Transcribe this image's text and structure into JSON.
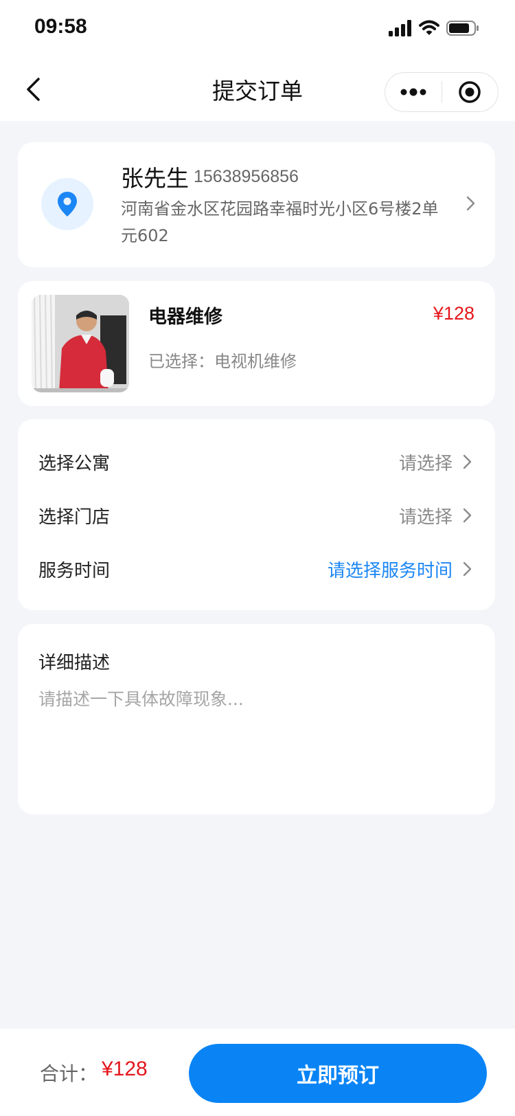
{
  "status_bar": {
    "time": "09:58"
  },
  "nav": {
    "title": "提交订单"
  },
  "address": {
    "name": "张先生",
    "phone": "15638956856",
    "detail": "河南省金水区花园路幸福时光小区6号楼2单元602"
  },
  "product": {
    "name": "电器维修",
    "price": "¥128",
    "selection": "已选择：电视机维修"
  },
  "options": [
    {
      "label": "选择公寓",
      "value": "请选择"
    },
    {
      "label": "选择门店",
      "value": "请选择"
    },
    {
      "label": "服务时间",
      "value": "请选择服务时间"
    }
  ],
  "description": {
    "title": "详细描述",
    "placeholder": "请描述一下具体故障现象..."
  },
  "footer": {
    "total_label": "合计：",
    "total_price": "¥128",
    "book_label": "立即预订"
  },
  "colors": {
    "accent_blue": "#0a84f5",
    "price_red": "#e5161d",
    "background": "#f4f5f9"
  }
}
